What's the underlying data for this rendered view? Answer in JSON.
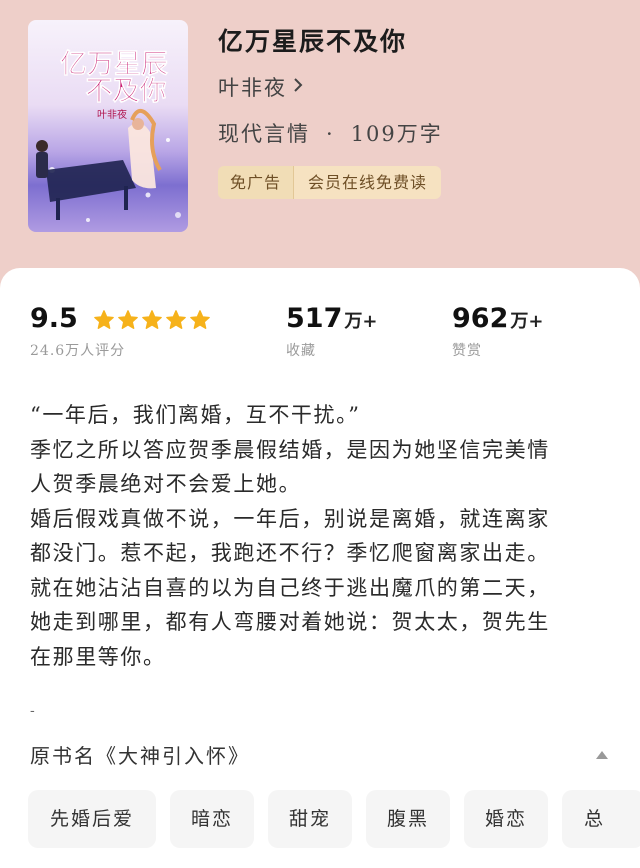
{
  "book": {
    "title": "亿万星辰不及你",
    "author": "叶非夜",
    "genre": "现代言情",
    "separator": "·",
    "word_count": "109万字"
  },
  "cover": {
    "title_line1": "亿万星辰",
    "title_line2": "不及你",
    "author": "叶非夜"
  },
  "badges": {
    "ad_free": "免广告",
    "member": "会员在线免费读"
  },
  "stats": {
    "rating": "9.5",
    "rating_stars": 5,
    "rating_count": "24.6万人评分",
    "favorites_num": "517",
    "favorites_unit": "万+",
    "favorites_label": "收藏",
    "rewards_num": "962",
    "rewards_unit": "万+",
    "rewards_label": "赞赏"
  },
  "synopsis": {
    "line1": "“一年后，我们离婚，互不干扰。”",
    "line2": "季忆之所以答应贺季晨假结婚，是因为她坚信完美情",
    "line3": "人贺季晨绝对不会爱上她。",
    "line4": "婚后假戏真做不说，一年后，别说是离婚，就连离家",
    "line5": "都没门。惹不起，我跑还不行？季忆爬窗离家出走。",
    "line6": "就在她沾沾自喜的以为自己终于逃出魔爪的第二天，",
    "line7": "她走到哪里，都有人弯腰对着她说：贺太太，贺先生",
    "line8": "在那里等你。",
    "dash": "-"
  },
  "original_title": "原书名《大神引入怀》",
  "tags": [
    "先婚后爱",
    "暗恋",
    "甜宠",
    "腹黑",
    "婚恋",
    "总"
  ],
  "colors": {
    "header_bg": "#eecfc9",
    "star": "#f6b21b",
    "badge_bg": "#f3e0bc",
    "tag_bg": "#f5f5f5"
  }
}
